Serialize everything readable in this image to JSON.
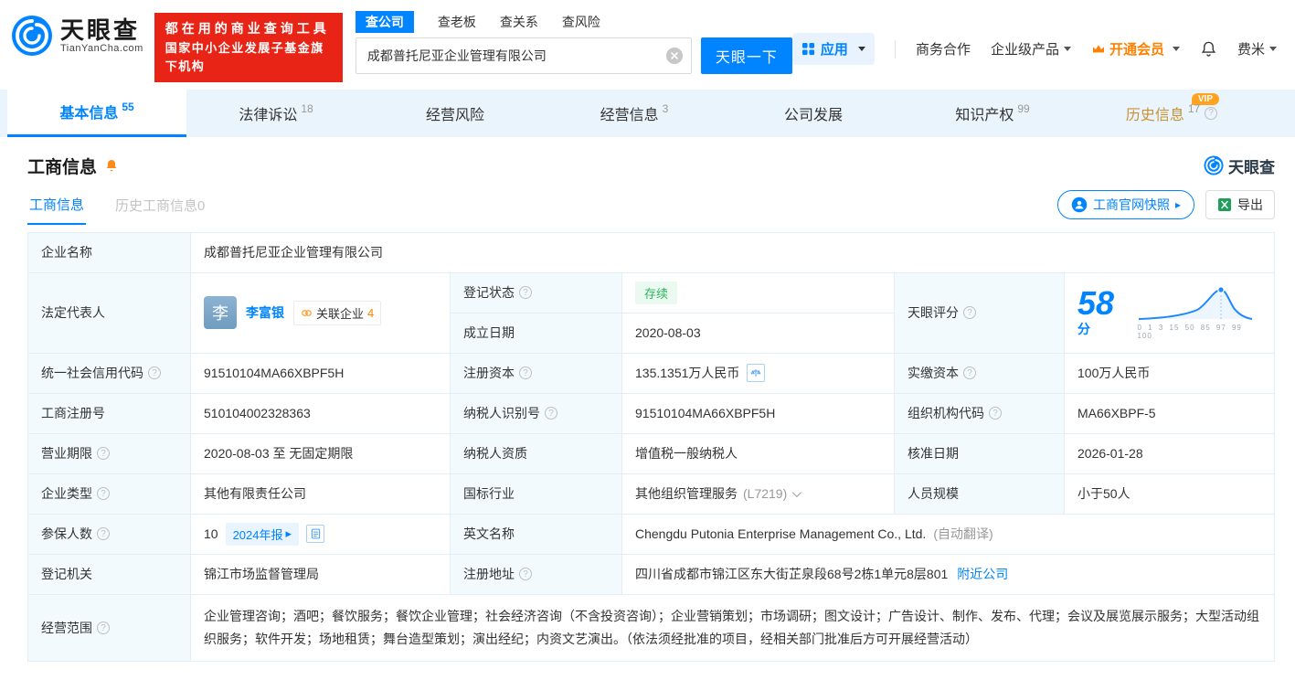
{
  "icons": {
    "question": "?",
    "arrow_right": "▸",
    "close_hint": "clear"
  },
  "header": {
    "logo_title": "天眼查",
    "logo_subtitle": "TianYanCha.com",
    "banner_line1": "都在用的商业查询工具",
    "banner_line2": "国家中小企业发展子基金旗下机构",
    "search_tabs": [
      {
        "label": "查公司"
      },
      {
        "label": "查老板"
      },
      {
        "label": "查关系"
      },
      {
        "label": "查风险"
      }
    ],
    "search_value": "成都普托尼亚企业管理有限公司",
    "search_button": "天眼一下",
    "nav_app": "应用",
    "nav_cooperation": "商务合作",
    "nav_enterprise": "企业级产品",
    "nav_vip": "开通会员",
    "nav_user": "费米"
  },
  "tabs": [
    {
      "label": "基本信息",
      "count": "55"
    },
    {
      "label": "法律诉讼",
      "count": "18"
    },
    {
      "label": "经营风险",
      "count": ""
    },
    {
      "label": "经营信息",
      "count": "3"
    },
    {
      "label": "公司发展",
      "count": ""
    },
    {
      "label": "知识产权",
      "count": "99"
    },
    {
      "label": "历史信息",
      "count": "17",
      "vip": "VIP"
    }
  ],
  "section": {
    "title": "工商信息",
    "brand": "天眼查",
    "subtab_active": "工商信息",
    "subtab_inactive": "历史工商信息0",
    "snapshot_button": "工商官网快照",
    "export_button": "导出"
  },
  "fields": {
    "company_name": {
      "label": "企业名称",
      "value": "成都普托尼亚企业管理有限公司"
    },
    "legal_rep": {
      "label": "法定代表人",
      "avatar": "李",
      "name": "李富银",
      "related": "关联企业",
      "related_count": "4"
    },
    "reg_status": {
      "label": "登记状态",
      "value": "存续"
    },
    "establish_date": {
      "label": "成立日期",
      "value": "2020-08-03"
    },
    "score": {
      "label": "天眼评分",
      "value": "58",
      "unit": "分",
      "axis": "0 1 3 15 50 85 97 99 100"
    },
    "credit_code": {
      "label": "统一社会信用代码",
      "value": "91510104MA66XBPF5H"
    },
    "reg_capital": {
      "label": "注册资本",
      "value": "135.1351万人民币"
    },
    "paid_capital": {
      "label": "实缴资本",
      "value": "100万人民币"
    },
    "reg_number": {
      "label": "工商注册号",
      "value": "510104002328363"
    },
    "taxpayer_id": {
      "label": "纳税人识别号",
      "value": "91510104MA66XBPF5H"
    },
    "org_code": {
      "label": "组织机构代码",
      "value": "MA66XBPF-5"
    },
    "business_term": {
      "label": "营业期限",
      "value": "2020-08-03 至 无固定期限"
    },
    "taxpayer_quality": {
      "label": "纳税人资质",
      "value": "增值税一般纳税人"
    },
    "approval_date": {
      "label": "核准日期",
      "value": "2026-01-28"
    },
    "company_type": {
      "label": "企业类型",
      "value": "其他有限责任公司"
    },
    "industry": {
      "label": "国标行业",
      "value": "其他组织管理服务",
      "code": "(L7219)"
    },
    "staff_size": {
      "label": "人员规模",
      "value": "小于50人"
    },
    "insured_count": {
      "label": "参保人数",
      "value": "10",
      "tag": "2024年报"
    },
    "english_name": {
      "label": "英文名称",
      "value": "Chengdu Putonia Enterprise Management Co., Ltd.",
      "note": "(自动翻译)"
    },
    "reg_authority": {
      "label": "登记机关",
      "value": "锦江市场监督管理局"
    },
    "reg_address": {
      "label": "注册地址",
      "value": "四川省成都市锦江区东大街芷泉段68号2栋1单元8层801",
      "link": "附近公司"
    },
    "business_scope": {
      "label": "经营范围",
      "value": "企业管理咨询；酒吧；餐饮服务；餐饮企业管理；社会经济咨询（不含投资咨询）；企业营销策划；市场调研；图文设计；广告设计、制作、发布、代理；会议及展览展示服务；大型活动组织服务；软件开发；场地租赁；舞台造型策划；演出经纪；内资文艺演出。（依法须经批准的项目，经相关部门批准后方可开展经营活动）"
    }
  }
}
